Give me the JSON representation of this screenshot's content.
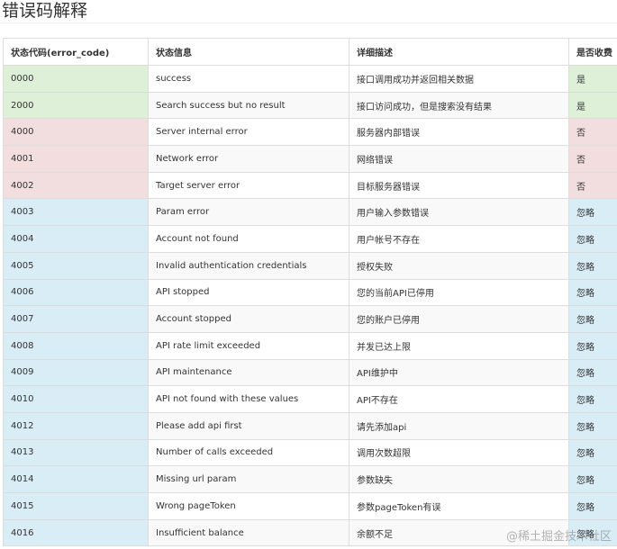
{
  "page": {
    "title": "错误码解释",
    "watermark": "@稀土掘金技术社区"
  },
  "colors": {
    "success_row": "#dff0d8",
    "error_row": "#f2dede",
    "ignore_row": "#d9edf7",
    "border": "#dddddd"
  },
  "table": {
    "headers": [
      "状态代码(error_code)",
      "状态信息",
      "详细描述",
      "是否收费"
    ],
    "rows": [
      {
        "code": "0000",
        "message": "success",
        "description": "接口调用成功并返回相关数据",
        "charge": "是",
        "type": "green"
      },
      {
        "code": "2000",
        "message": "Search success but no result",
        "description": "接口访问成功，但是搜索没有结果",
        "charge": "是",
        "type": "green"
      },
      {
        "code": "4000",
        "message": "Server internal error",
        "description": "服务器内部错误",
        "charge": "否",
        "type": "red"
      },
      {
        "code": "4001",
        "message": "Network error",
        "description": "网络错误",
        "charge": "否",
        "type": "red"
      },
      {
        "code": "4002",
        "message": "Target server error",
        "description": "目标服务器错误",
        "charge": "否",
        "type": "red"
      },
      {
        "code": "4003",
        "message": "Param error",
        "description": "用户输入参数错误",
        "charge": "忽略",
        "type": "blue"
      },
      {
        "code": "4004",
        "message": "Account not found",
        "description": "用户帐号不存在",
        "charge": "忽略",
        "type": "blue"
      },
      {
        "code": "4005",
        "message": "Invalid authentication credentials",
        "description": "授权失败",
        "charge": "忽略",
        "type": "blue"
      },
      {
        "code": "4006",
        "message": "API stopped",
        "description": "您的当前API已停用",
        "charge": "忽略",
        "type": "blue"
      },
      {
        "code": "4007",
        "message": "Account stopped",
        "description": "您的账户已停用",
        "charge": "忽略",
        "type": "blue"
      },
      {
        "code": "4008",
        "message": "API rate limit exceeded",
        "description": "并发已达上限",
        "charge": "忽略",
        "type": "blue"
      },
      {
        "code": "4009",
        "message": "API maintenance",
        "description": "API维护中",
        "charge": "忽略",
        "type": "blue"
      },
      {
        "code": "4010",
        "message": "API not found with these values",
        "description": "API不存在",
        "charge": "忽略",
        "type": "blue"
      },
      {
        "code": "4012",
        "message": "Please add api first",
        "description": "请先添加api",
        "charge": "忽略",
        "type": "blue"
      },
      {
        "code": "4013",
        "message": "Number of calls exceeded",
        "description": "调用次数超限",
        "charge": "忽略",
        "type": "blue"
      },
      {
        "code": "4014",
        "message": "Missing url param",
        "description": "参数缺失",
        "charge": "忽略",
        "type": "blue"
      },
      {
        "code": "4015",
        "message": "Wrong pageToken",
        "description": "参数pageToken有误",
        "charge": "忽略",
        "type": "blue"
      },
      {
        "code": "4016",
        "message": "Insufficient balance",
        "description": "余额不足",
        "charge": "忽略",
        "type": "blue"
      }
    ]
  }
}
